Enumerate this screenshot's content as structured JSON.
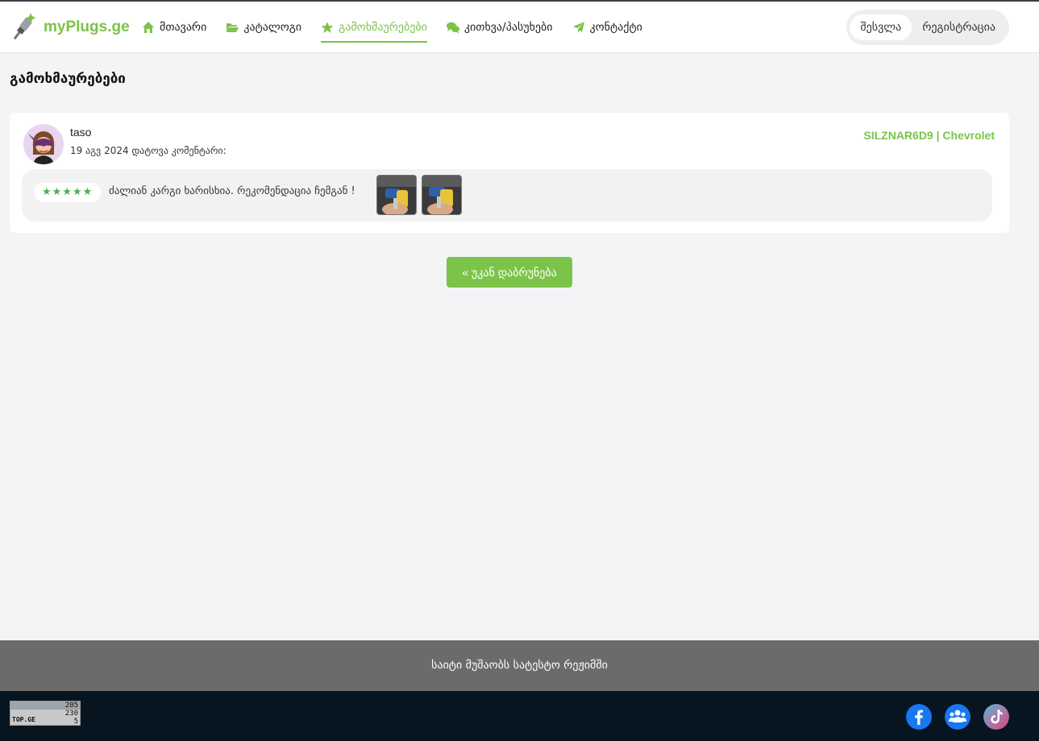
{
  "header": {
    "logo_text": "myPlugs.ge",
    "nav": [
      {
        "label": "მთავარი",
        "icon": "home-icon"
      },
      {
        "label": "კატალოგი",
        "icon": "folder-icon"
      },
      {
        "label": "გამოხმაურებები",
        "icon": "star-icon",
        "active": true
      },
      {
        "label": "კითხვა/პასუხები",
        "icon": "chat-icon"
      },
      {
        "label": "კონტაქტი",
        "icon": "paper-plane-icon"
      }
    ],
    "login_label": "შესვლა",
    "register_label": "რეგისტრაცია"
  },
  "page": {
    "title": "გამოხმაურებები"
  },
  "review": {
    "user": "taso",
    "meta": "19 აგვ 2024 დატოვა კომენტარი:",
    "product": "SILZNAR6D9 | Chevrolet",
    "stars": "★★★★★",
    "rating": 5,
    "text": "ძალიან კარგი ხარისხია. რეკომენდაცია ჩემგან !"
  },
  "back_label": "« უკან დაბრუნება",
  "footer": {
    "notice": "საიტი მუშაობს სატესტო რეჟიმში",
    "counter": {
      "brand": "TOP.GE",
      "values": [
        "205",
        "230",
        "5"
      ]
    }
  },
  "colors": {
    "accent": "#7cc34a",
    "footer_gray": "#6b6b6b",
    "footer_dark": "#071521",
    "facebook": "#1877f2"
  }
}
